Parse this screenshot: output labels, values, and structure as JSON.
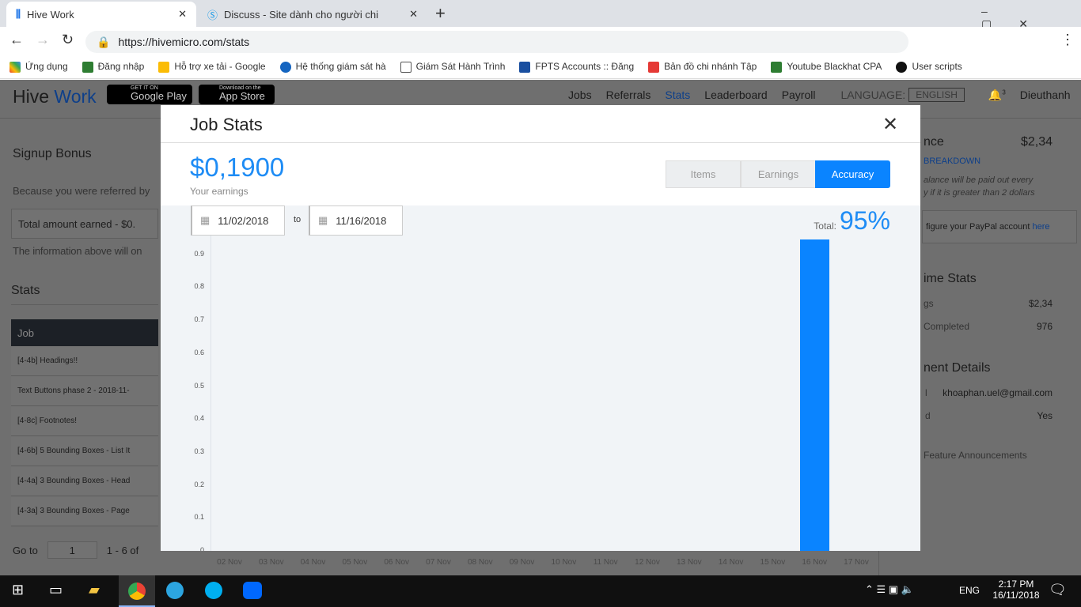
{
  "browser": {
    "tabs": [
      {
        "title": "Hive Work",
        "active": true
      },
      {
        "title": "Discuss - Site dành cho người chi"
      }
    ],
    "url": "https://hivemicro.com/stats",
    "bookmarks": [
      "Ứng dụng",
      "Đăng nhập",
      "Hỗ trợ xe tải - Google",
      "Hệ thống giám sát hà",
      "Giám Sát Hành Trình",
      "FPTS Accounts :: Đăng",
      "Bản đồ chi nhánh Tập",
      "Youtube Blackhat CPA",
      "User scripts"
    ]
  },
  "site": {
    "logo_a": "Hive",
    "logo_b": "Work",
    "google_play": {
      "small": "GET IT ON",
      "big": "Google Play"
    },
    "app_store": {
      "small": "Download on the",
      "big": "App Store"
    },
    "nav": [
      "Jobs",
      "Referrals",
      "Stats",
      "Leaderboard",
      "Payroll"
    ],
    "language_label": "LANGUAGE:",
    "language": "ENGLISH",
    "notifications": "3",
    "user": "Dieuthanh"
  },
  "left": {
    "signup_title": "Signup Bonus",
    "referred_text": "Because you were referred by",
    "total_earned": "Total amount earned - $0.",
    "info_text": "The information above will on",
    "stats_title": "Stats",
    "job_header": "Job",
    "jobs": [
      "[4-4b] Headings!!",
      "Text Buttons phase 2 - 2018-11-",
      "[4-8c] Footnotes!",
      "[4-6b] 5 Bounding Boxes - List It",
      "[4-4a] 3 Bounding Boxes - Head",
      "[4-3a] 3 Bounding Boxes - Page"
    ],
    "goto_label": "Go to",
    "goto_value": "1",
    "range": "1 - 6 of"
  },
  "right": {
    "balance_label": "nce",
    "balance": "$2,34",
    "breakdown": "BREAKDOWN",
    "payout_note_1": "alance will be paid out every",
    "payout_note_2": "y if it is greater than 2 dollars",
    "paypal_text": "figure your PayPal account ",
    "paypal_link": "here",
    "lifetime_title": "ime Stats",
    "earnings_label": "gs",
    "earnings": "$2,34",
    "completed_label": "Completed",
    "completed": "976",
    "payment_title": "nent Details",
    "email_label": "l",
    "email": "khoaphan.uel@gmail.com",
    "verified_label": "d",
    "verified": "Yes",
    "announcements": "Feature Announcements"
  },
  "modal": {
    "title": "Job Stats",
    "earnings": "$0,1900",
    "earnings_label": "Your earnings",
    "segments": [
      {
        "label": "Items"
      },
      {
        "label": "Earnings"
      },
      {
        "label": "Accuracy",
        "active": true
      }
    ],
    "date_from": "11/02/2018",
    "date_to_label": "to",
    "date_to": "11/16/2018",
    "total_label": "Total:",
    "total": "95%"
  },
  "chart_data": {
    "type": "bar",
    "categories": [
      "02 Nov",
      "03 Nov",
      "04 Nov",
      "05 Nov",
      "06 Nov",
      "07 Nov",
      "08 Nov",
      "09 Nov",
      "10 Nov",
      "11 Nov",
      "12 Nov",
      "13 Nov",
      "14 Nov",
      "15 Nov",
      "16 Nov",
      "17 Nov"
    ],
    "values": [
      0,
      0,
      0,
      0,
      0,
      0,
      0,
      0,
      0,
      0,
      0,
      0,
      0,
      0,
      0.95,
      0
    ],
    "yticks": [
      "0",
      "0.1",
      "0.2",
      "0.3",
      "0.4",
      "0.5",
      "0.6",
      "0.7",
      "0.8",
      "0.9"
    ],
    "ylim": [
      0,
      1
    ],
    "color": "#0a84ff"
  },
  "taskbar": {
    "lang": "ENG",
    "time": "2:17 PM",
    "date": "16/11/2018"
  }
}
